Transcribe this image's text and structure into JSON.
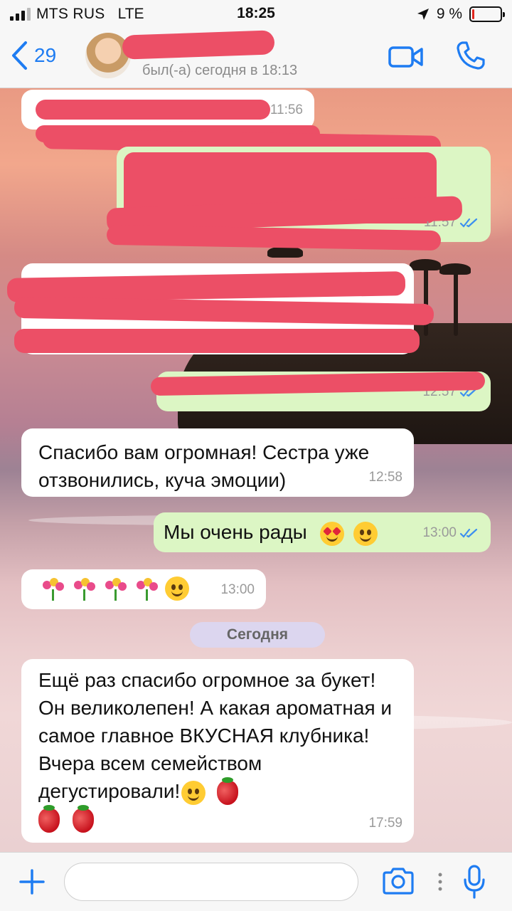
{
  "status_bar": {
    "carrier": "MTS RUS",
    "network": "LTE",
    "time": "18:25",
    "battery_percent": "9 %",
    "battery_level": 0.09
  },
  "nav": {
    "back_count": "29",
    "contact_status": "был(-а) сегодня в 18:13",
    "icons": [
      "chevron-left-icon",
      "video-camera-icon",
      "phone-icon"
    ]
  },
  "messages": [
    {
      "dir": "in",
      "text": "",
      "time": "11:56",
      "redacted": true
    },
    {
      "dir": "out",
      "text": "",
      "time": "11:57",
      "redacted": true,
      "read": true
    },
    {
      "dir": "in",
      "text": "",
      "time": "",
      "redacted": true
    },
    {
      "dir": "out",
      "text": "",
      "time": "12:57",
      "redacted": true,
      "read": true
    },
    {
      "dir": "in",
      "text": "Спасибо вам огромная! Сестра уже отзвонились, куча эмоции)",
      "time": "12:58"
    },
    {
      "dir": "out",
      "text": "Мы очень рады",
      "emojis": [
        "heart-eyes-cat",
        "smiling-face"
      ],
      "time": "13:00",
      "read": true
    },
    {
      "dir": "in",
      "text": "",
      "emojis": [
        "bouquet",
        "bouquet",
        "bouquet",
        "bouquet",
        "hugging-face"
      ],
      "time": "13:00"
    },
    {
      "dir": "in",
      "text": "Ещё раз спасибо огромное за букет! Он великолепен! А какая ароматная и самое главное ВКУСНАЯ клубника! Вчера всем семейством дегустировали!",
      "emojis": [
        "hugging-face",
        "strawberry",
        "strawberry",
        "strawberry"
      ],
      "time": "17:59"
    }
  ],
  "date_separator": "Сегодня",
  "input": {
    "placeholder": "",
    "icons": [
      "plus-icon",
      "camera-icon",
      "more-dots-icon",
      "microphone-icon"
    ]
  },
  "colors": {
    "accent": "#1e7cf2",
    "incoming_bubble": "#ffffff",
    "outgoing_bubble": "#dcf6c4",
    "redaction": "#ec4f66",
    "read_ticks": "#3b8ff0"
  }
}
